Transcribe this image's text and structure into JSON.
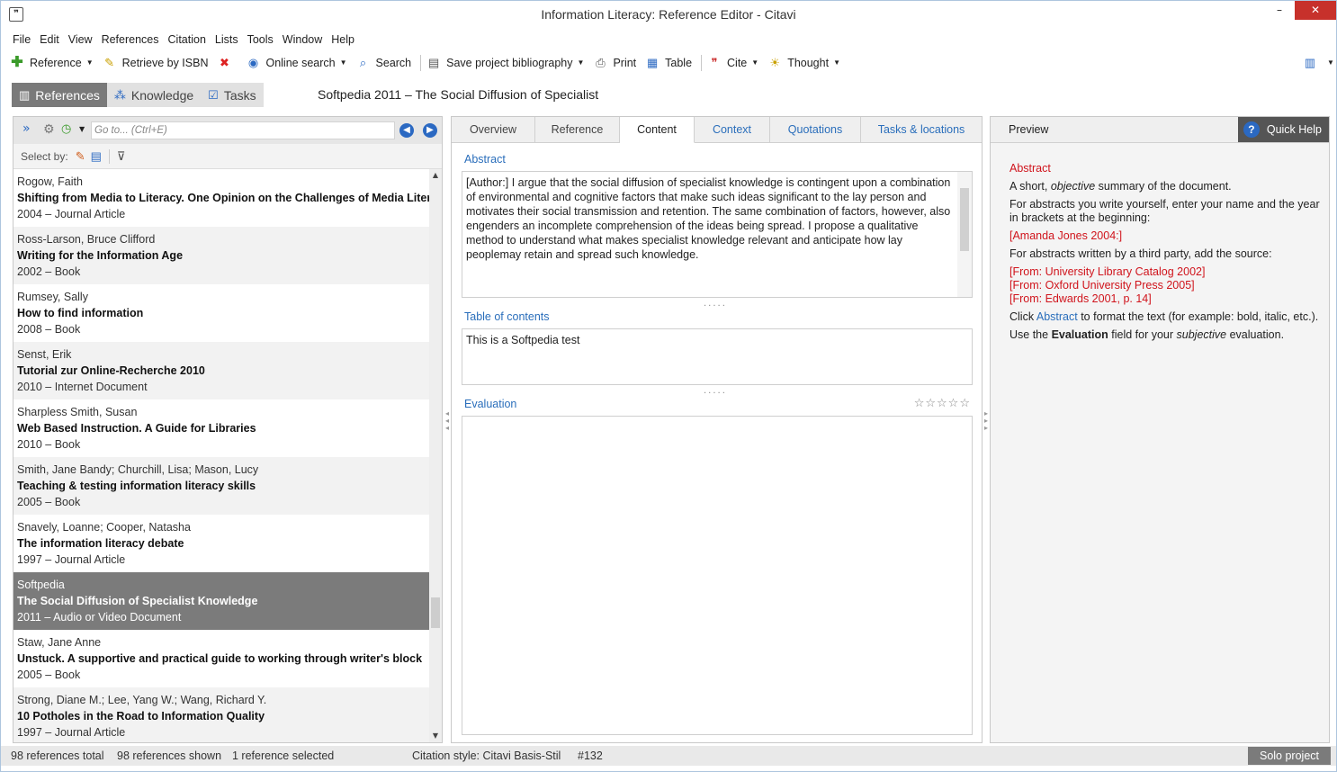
{
  "window": {
    "title": "Information Literacy: Reference Editor - Citavi",
    "app_icon": "❞",
    "minimize": "–",
    "maximize": "□",
    "close": "✕"
  },
  "menu": [
    "File",
    "Edit",
    "View",
    "References",
    "Citation",
    "Lists",
    "Tools",
    "Window",
    "Help"
  ],
  "toolbar": {
    "reference": "Reference",
    "retrieve_isbn": "Retrieve by ISBN",
    "online_search": "Online search",
    "search": "Search",
    "save_bibliography": "Save project bibliography",
    "print": "Print",
    "table": "Table",
    "cite": "Cite",
    "thought": "Thought"
  },
  "modes": [
    {
      "label": "References",
      "icon": "books-icon",
      "active": true
    },
    {
      "label": "Knowledge",
      "icon": "knowledge-icon",
      "active": false
    },
    {
      "label": "Tasks",
      "icon": "tasks-icon",
      "active": false
    }
  ],
  "project_title": "Softpedia 2011 – The Social Diffusion of Specialist",
  "left": {
    "goto_placeholder": "Go to... (Ctrl+E)",
    "select_by": "Select by:",
    "references": [
      {
        "author": "Rogow, Faith",
        "title": "Shifting from Media to Literacy. One Opinion on the Challenges of Media Literacy",
        "meta": "2004 – Journal Article"
      },
      {
        "author": "Ross-Larson, Bruce Clifford",
        "title": "Writing for the Information Age",
        "meta": "2002 – Book"
      },
      {
        "author": "Rumsey, Sally",
        "title": "How to find information",
        "meta": "2008 – Book"
      },
      {
        "author": "Senst, Erik",
        "title": "Tutorial zur Online-Recherche 2010",
        "meta": "2010 – Internet Document"
      },
      {
        "author": "Sharpless Smith, Susan",
        "title": "Web Based Instruction. A Guide for Libraries",
        "meta": "2010 – Book"
      },
      {
        "author": "Smith, Jane Bandy; Churchill, Lisa; Mason, Lucy",
        "title": "Teaching & testing information literacy skills",
        "meta": "2005 – Book"
      },
      {
        "author": "Snavely, Loanne; Cooper, Natasha",
        "title": "The information literacy debate",
        "meta": "1997 – Journal Article"
      },
      {
        "author": "Softpedia",
        "title": "The Social Diffusion of Specialist Knowledge",
        "meta": "2011 – Audio or Video Document",
        "selected": true
      },
      {
        "author": "Staw, Jane Anne",
        "title": "Unstuck. A supportive and practical guide to working through writer's block",
        "meta": "2005 – Book"
      },
      {
        "author": "Strong, Diane M.; Lee, Yang W.; Wang, Richard Y.",
        "title": "10 Potholes in the Road to Information Quality",
        "meta": "1997 – Journal Article"
      }
    ]
  },
  "center": {
    "tabs": [
      {
        "label": "Overview",
        "w": 93
      },
      {
        "label": "Reference",
        "w": 94
      },
      {
        "label": "Content",
        "w": 83,
        "active": true
      },
      {
        "label": "Context",
        "w": 84
      },
      {
        "label": "Quotations",
        "w": 101
      },
      {
        "label": "Tasks & locations",
        "w": 134
      }
    ],
    "abstract_label": "Abstract",
    "abstract_text": "[Author:] I argue that the social diffusion of specialist knowledge is contingent upon a combination of environmental and cognitive factors that make such ideas significant to the lay person and motivates their social transmission and retention. The same combination of factors, however, also engenders an incomplete comprehension of the ideas being spread. I propose a qualitative method to understand what makes specialist knowledge relevant and anticipate how lay peoplemay retain and spread such knowledge.",
    "toc_label": "Table of contents",
    "toc_text": "This is a Softpedia test",
    "evaluation_label": "Evaluation",
    "rating": "☆☆☆☆☆"
  },
  "right": {
    "preview": "Preview",
    "quick_help": "Quick Help",
    "help": {
      "h": "Abstract",
      "l1a": "A short, ",
      "l1b": "objective",
      "l1c": " summary of the document.",
      "l2": "For abstracts you write yourself, enter your name and the year in brackets at the beginning:",
      "ex1": "[Amanda Jones 2004:]",
      "l3": "For abstracts written by a third party, add the source:",
      "ex2": "[From: University Library Catalog 2002]",
      "ex3": "[From: Oxford University Press 2005]",
      "ex4": "[From: Edwards 2001, p. 14]",
      "l4a": "Click ",
      "l4b": "Abstract",
      "l4c": " to format the text (for example: bold, italic, etc.).",
      "l5a": "Use the ",
      "l5b": "Evaluation",
      "l5c": " field for your ",
      "l5d": "subjective",
      "l5e": " evaluation."
    }
  },
  "status": {
    "total": "98 references total",
    "shown": "98 references shown",
    "selected": "1 reference selected",
    "style": "Citation style: Citavi Basis-Stil",
    "id": "#132",
    "solo": "Solo project"
  }
}
